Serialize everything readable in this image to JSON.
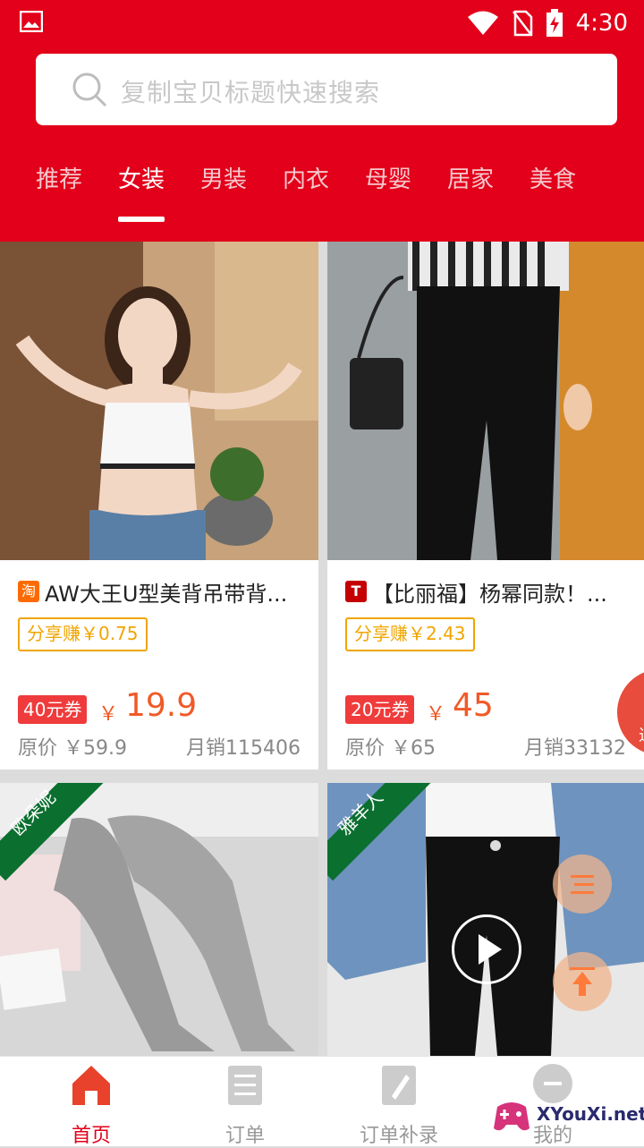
{
  "status": {
    "time": "4:30"
  },
  "search": {
    "placeholder": "复制宝贝标题快速搜索"
  },
  "tabs": [
    "推荐",
    "女装",
    "男装",
    "内衣",
    "母婴",
    "居家",
    "美食"
  ],
  "active_tab": "女装",
  "products": [
    {
      "platform_icon": "淘",
      "title": "AW大王U型美背吊带背...",
      "share": "分享赚￥0.75",
      "coupon": "40元券",
      "yen": "￥",
      "price": "19.9",
      "original": "原价 ￥59.9",
      "sales": "月销115406"
    },
    {
      "platform_icon": "T",
      "title": "【比丽福】杨幂同款！...",
      "share": "分享赚￥2.43",
      "coupon": "20元券",
      "yen": "￥",
      "price": "45",
      "original": "原价 ￥65",
      "sales": "月销33132"
    }
  ],
  "brand_tags": [
    "欧朵妮",
    "雅羊人"
  ],
  "side_tab": {
    "char": "进"
  },
  "nav": [
    {
      "label": "首页",
      "icon": "home-icon"
    },
    {
      "label": "订单",
      "icon": "list-icon"
    },
    {
      "label": "订单补录",
      "icon": "edit-doc-icon"
    },
    {
      "label": "我的",
      "icon": "user-icon"
    }
  ],
  "watermark": "XYouXi.net",
  "colors": {
    "brand_red": "#e2001a",
    "price_orange": "#f05a28",
    "share_gold": "#f0a500"
  }
}
